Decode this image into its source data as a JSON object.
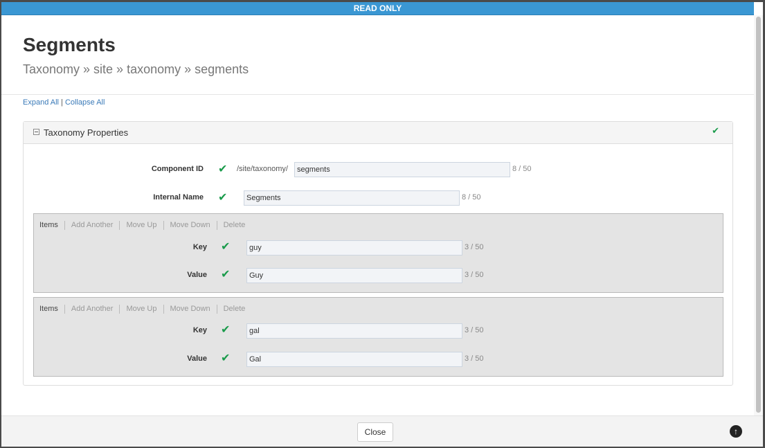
{
  "banner": "READ ONLY",
  "title": "Segments",
  "breadcrumb": "Taxonomy » site » taxonomy » segments",
  "links": {
    "expand": "Expand All",
    "separator": "|",
    "collapse": "Collapse All"
  },
  "panel": {
    "title": "Taxonomy Properties",
    "component_id": {
      "label": "Component ID",
      "prefix": "/site/taxonomy/",
      "value": "segments",
      "count": "8 / 50"
    },
    "internal_name": {
      "label": "Internal Name",
      "value": "Segments",
      "count": "8 / 50"
    }
  },
  "toolbar": {
    "items": "Items",
    "add": "Add Another",
    "up": "Move Up",
    "down": "Move Down",
    "delete": "Delete"
  },
  "items": [
    {
      "key_label": "Key",
      "key": "guy",
      "key_count": "3 / 50",
      "value_label": "Value",
      "value": "Guy",
      "value_count": "3 / 50"
    },
    {
      "key_label": "Key",
      "key": "gal",
      "key_count": "3 / 50",
      "value_label": "Value",
      "value": "Gal",
      "value_count": "3 / 50"
    }
  ],
  "footer": {
    "close": "Close",
    "scroll_top_icon": "arrow-up-circle-icon"
  },
  "colors": {
    "banner": "#3a97d3",
    "check": "#1a9b4b",
    "link": "#3a7ab8"
  }
}
